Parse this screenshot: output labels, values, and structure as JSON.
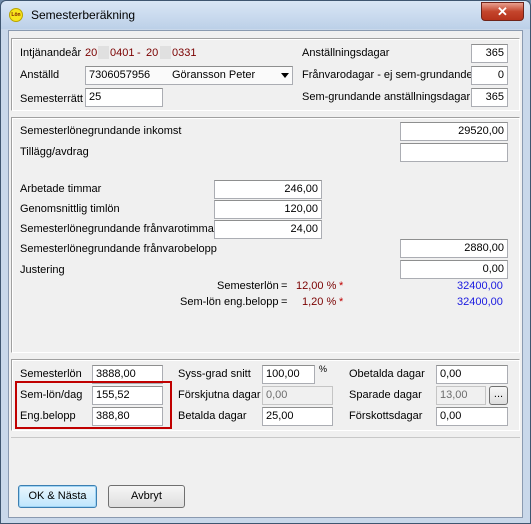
{
  "window": {
    "title": "Semesterberäkning",
    "icon_text": "Lön",
    "close_glyph": "✕"
  },
  "top": {
    "intjanandear_label": "Intjänandeår",
    "intjanandear_from_prefix": "20",
    "intjanandear_from_suffix": "0401",
    "intjanandear_dash": "-",
    "intjanandear_to_prefix": "20",
    "intjanandear_to_suffix": "0331",
    "anstalld_label": "Anställd",
    "anstalld_id": "7306057956",
    "anstalld_name": "Göransson Peter",
    "semesterratt_label": "Semesterrätt",
    "semesterratt_value": "25",
    "anstallningsdagar_label": "Anställningsdagar",
    "anstallningsdagar_value": "365",
    "franvarodagar_label": "Frånvarodagar - ej sem-grundande",
    "franvarodagar_value": "0",
    "semgrundande_label": "Sem-grundande anställningsdagar",
    "semgrundande_value": "365"
  },
  "middle": {
    "inkomst_label": "Semesterlönegrundande inkomst",
    "inkomst_value": "29520,00",
    "tillagg_label": "Tillägg/avdrag",
    "tillagg_value": "",
    "arbetade_label": "Arbetade timmar",
    "arbetade_value": "246,00",
    "timlon_label": "Genomsnittlig timlön",
    "timlon_value": "120,00",
    "franvarotimmar_label": "Semesterlönegrundande frånvarotimmar",
    "franvarotimmar_value": "24,00",
    "franvarobelopp_label": "Semesterlönegrundande frånvarobelopp",
    "franvarobelopp_value": "2880,00",
    "justering_label": "Justering",
    "justering_value": "0,00",
    "semesterlon_calc_label": "Semesterlön",
    "semesterlon_calc_eq": "=",
    "semesterlon_calc_pct": "12,00 %",
    "semesterlon_calc_star": "*",
    "semesterlon_calc_result": "32400,00",
    "semlon_eng_label": "Sem-lön eng.belopp",
    "semlon_eng_eq": "=",
    "semlon_eng_pct": "1,20 %",
    "semlon_eng_star": "*",
    "semlon_eng_result": "32400,00"
  },
  "bottom": {
    "semesterlon_label": "Semesterlön",
    "semesterlon_value": "3888,00",
    "semlon_dag_label": "Sem-lön/dag",
    "semlon_dag_value": "155,52",
    "eng_belopp_label": "Eng.belopp",
    "eng_belopp_value": "388,80",
    "syss_grad_label": "Syss-grad snitt",
    "syss_grad_value": "100,00",
    "syss_grad_unit": "%",
    "forskjutna_label": "Förskjutna dagar",
    "forskjutna_value": "0,00",
    "betalda_label": "Betalda dagar",
    "betalda_value": "25,00",
    "obetalda_label": "Obetalda dagar",
    "obetalda_value": "0,00",
    "sparade_label": "Sparade dagar",
    "sparade_value": "13,00",
    "sparade_button": "...",
    "forskott_label": "Förskottsdagar",
    "forskott_value": "0,00"
  },
  "buttons": {
    "ok_label": "OK & Nästa",
    "cancel_label": "Avbryt"
  },
  "colors": {
    "highlight": "#c00000",
    "result_blue": "#1a1ae0",
    "pct_red": "#7a0000"
  }
}
